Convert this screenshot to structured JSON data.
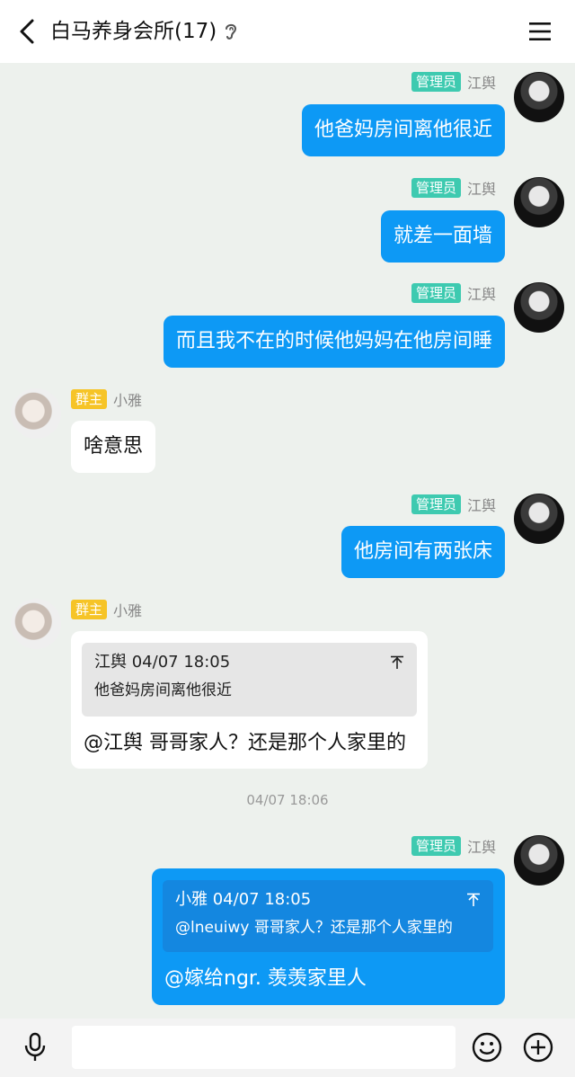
{
  "header": {
    "title": "白马养身会所(17)"
  },
  "messages": [
    {
      "badge": "管理员",
      "sender": "江舆",
      "text": "他爸妈房间离他很近"
    },
    {
      "badge": "管理员",
      "sender": "江舆",
      "text": "就差一面墙"
    },
    {
      "badge": "管理员",
      "sender": "江舆",
      "text": "而且我不在的时候他妈妈在他房间睡"
    },
    {
      "badge": "群主",
      "sender": "小雅",
      "text": "啥意思"
    },
    {
      "badge": "管理员",
      "sender": "江舆",
      "text": "他房间有两张床"
    },
    {
      "badge": "群主",
      "sender": "小雅",
      "quote": {
        "author_time": "江舆 04/07 18:05",
        "text": "他爸妈房间离他很近"
      },
      "text": "@江舆 哥哥家人？还是那个人家里的"
    },
    {
      "time": "04/07 18:06"
    },
    {
      "badge": "管理员",
      "sender": "江舆",
      "quote": {
        "author_time": "小雅 04/07 18:05",
        "text": "@lneuiwy 哥哥家人？还是那个人家里的"
      },
      "text": "@嫁给ngr. 羡羡家里人"
    }
  ],
  "input": {
    "value": ""
  },
  "icons": {
    "back": "chevron-left-icon",
    "ear": "ear-icon",
    "menu": "hamburger-menu-icon",
    "quote_jump": "jump-to-original-icon",
    "mic": "microphone-icon",
    "emoji": "emoji-icon",
    "plus": "plus-circle-icon"
  },
  "colors": {
    "accent": "#0d99f5",
    "admin_badge": "#3ecab0",
    "owner_badge": "#f6c427",
    "background": "#edf1ed"
  }
}
